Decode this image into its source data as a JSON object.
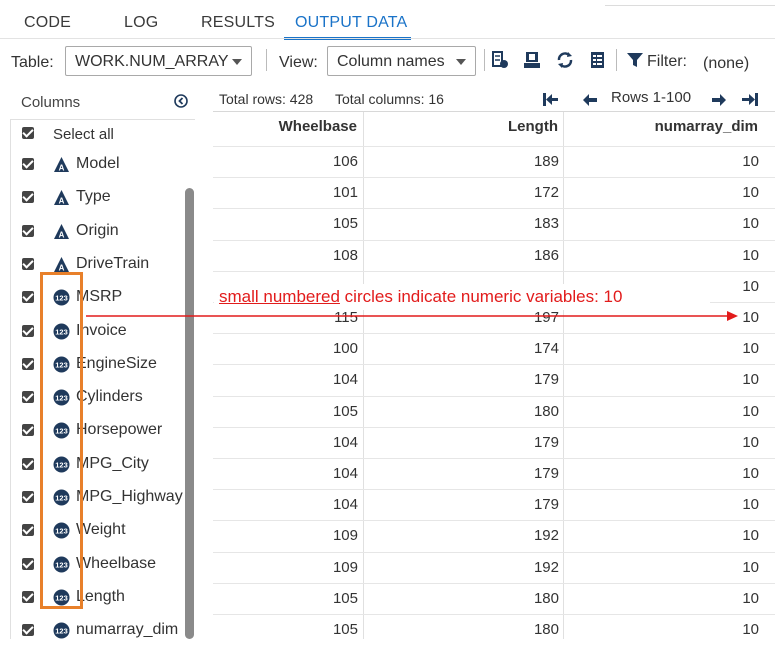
{
  "tabs": [
    {
      "label": "CODE"
    },
    {
      "label": "LOG"
    },
    {
      "label": "RESULTS"
    },
    {
      "label": "OUTPUT DATA"
    }
  ],
  "active_tab": "OUTPUT DATA",
  "toolbar": {
    "table_label": "Table:",
    "table_value": "WORK.NUM_ARRAY",
    "view_label": "View:",
    "view_value": "Column names",
    "filter_label": "Filter:",
    "filter_value": "(none)",
    "icons": [
      "data-view-icon",
      "download-icon",
      "refresh-icon",
      "table-properties-icon",
      "filter-icon"
    ]
  },
  "columns_panel": {
    "title": "Columns",
    "select_all": "Select all",
    "items": [
      {
        "name": "Model",
        "type": "character"
      },
      {
        "name": "Type",
        "type": "character"
      },
      {
        "name": "Origin",
        "type": "character"
      },
      {
        "name": "DriveTrain",
        "type": "character"
      },
      {
        "name": "MSRP",
        "type": "numeric"
      },
      {
        "name": "Invoice",
        "type": "numeric"
      },
      {
        "name": "EngineSize",
        "type": "numeric"
      },
      {
        "name": "Cylinders",
        "type": "numeric"
      },
      {
        "name": "Horsepower",
        "type": "numeric"
      },
      {
        "name": "MPG_City",
        "type": "numeric"
      },
      {
        "name": "MPG_Highway",
        "type": "numeric"
      },
      {
        "name": "Weight",
        "type": "numeric"
      },
      {
        "name": "Wheelbase",
        "type": "numeric"
      },
      {
        "name": "Length",
        "type": "numeric"
      },
      {
        "name": "numarray_dim",
        "type": "numeric"
      }
    ]
  },
  "grid": {
    "total_rows": "Total rows: 428",
    "total_columns": "Total columns: 16",
    "rows_range": "Rows 1-100",
    "headers": [
      "Wheelbase",
      "Length",
      "numarray_dim"
    ],
    "rows": [
      [
        "106",
        "189",
        "10"
      ],
      [
        "101",
        "172",
        "10"
      ],
      [
        "105",
        "183",
        "10"
      ],
      [
        "108",
        "186",
        "10"
      ],
      [
        "",
        "",
        "10"
      ],
      [
        "115",
        "197",
        "10"
      ],
      [
        "100",
        "174",
        "10"
      ],
      [
        "104",
        "179",
        "10"
      ],
      [
        "105",
        "180",
        "10"
      ],
      [
        "104",
        "179",
        "10"
      ],
      [
        "104",
        "179",
        "10"
      ],
      [
        "104",
        "179",
        "10"
      ],
      [
        "109",
        "192",
        "10"
      ],
      [
        "109",
        "192",
        "10"
      ],
      [
        "105",
        "180",
        "10"
      ],
      [
        "105",
        "180",
        "10"
      ]
    ]
  },
  "annotation": {
    "underlined": "small numbered",
    "rest": " circles indicate numeric variables: 10",
    "color": "#e21b1b",
    "box_color": "#e8802a"
  }
}
